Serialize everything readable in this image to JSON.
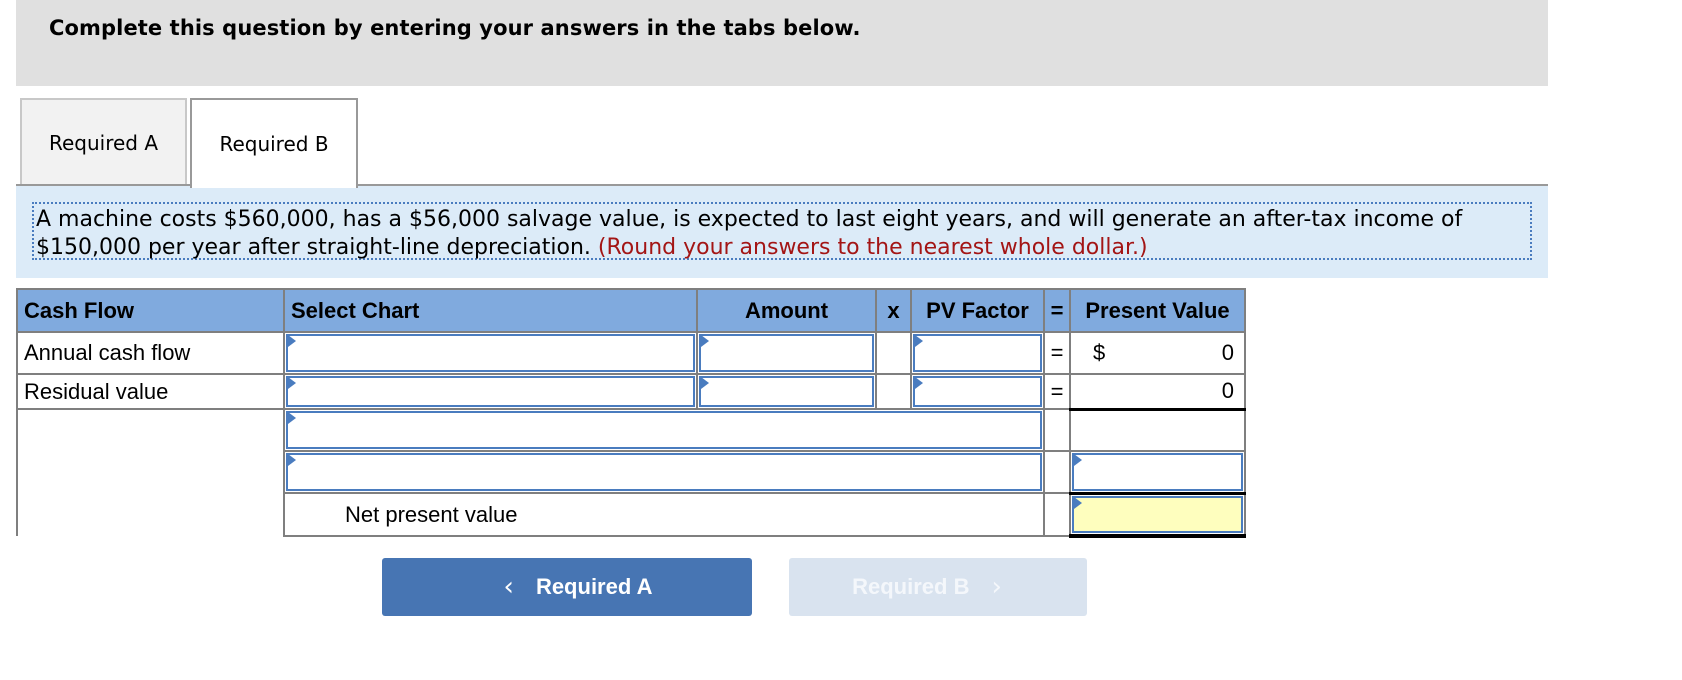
{
  "instruction": "Complete this question by entering your answers in the tabs below.",
  "tabs": [
    {
      "label": "Required A",
      "active": false
    },
    {
      "label": "Required B",
      "active": true
    }
  ],
  "problem": {
    "text": "A machine costs $560,000, has a $56,000 salvage value, is expected to last eight years, and will generate an after-tax income of $150,000 per year after straight-line depreciation.",
    "note": "(Round your answers to the nearest whole dollar.)"
  },
  "table": {
    "headers": {
      "cash_flow": "Cash Flow",
      "select_chart": "Select Chart",
      "amount": "Amount",
      "times": "x",
      "pv_factor": "PV Factor",
      "equals": "=",
      "present_value": "Present Value"
    },
    "rows": [
      {
        "label": "Annual cash flow",
        "select_chart": "",
        "amount": "",
        "pv_factor": "",
        "equals": "=",
        "currency": "$",
        "present_value": "0"
      },
      {
        "label": "Residual value",
        "select_chart": "",
        "amount": "",
        "pv_factor": "",
        "equals": "=",
        "present_value": "0"
      }
    ],
    "extra_rows": [
      {
        "input": "",
        "present_value": ""
      },
      {
        "input": "",
        "present_value": ""
      }
    ],
    "npv_label": "Net present value",
    "npv_value": ""
  },
  "nav": {
    "prev_label": "Required A",
    "next_label": "Required B",
    "prev_icon": "chevron-left",
    "next_icon": "chevron-right",
    "next_enabled": false
  },
  "colors": {
    "header_bg": "#80aade",
    "input_border": "#4a7cbf",
    "note_red": "#a31515",
    "npv_highlight": "#fefebe",
    "btn_primary": "#4775b3",
    "btn_disabled": "#d9e3ef"
  }
}
